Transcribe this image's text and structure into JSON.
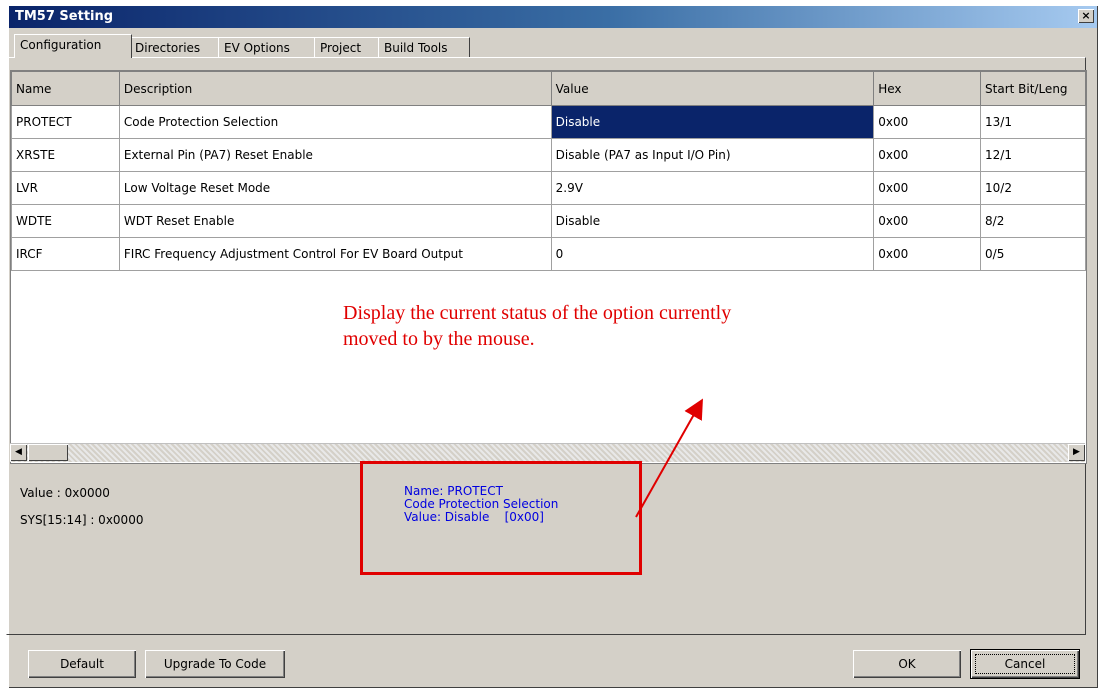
{
  "window": {
    "title": "TM57 Setting",
    "close_glyph": "×"
  },
  "tabs": [
    {
      "label": "Configuration"
    },
    {
      "label": "Directories"
    },
    {
      "label": "EV Options"
    },
    {
      "label": "Project"
    },
    {
      "label": "Build Tools"
    }
  ],
  "grid": {
    "columns": [
      "Name",
      "Description",
      "Value",
      "Hex",
      "Start Bit/Leng"
    ],
    "rows": [
      {
        "name": "PROTECT",
        "description": "Code Protection Selection",
        "value": "Disable",
        "hex": "0x00",
        "start": "13/1"
      },
      {
        "name": "XRSTE",
        "description": "External Pin (PA7) Reset Enable",
        "value": "Disable (PA7 as Input I/O Pin)",
        "hex": "0x00",
        "start": "12/1"
      },
      {
        "name": "LVR",
        "description": "Low Voltage Reset Mode",
        "value": "2.9V",
        "hex": "0x00",
        "start": "10/2"
      },
      {
        "name": "WDTE",
        "description": "WDT Reset Enable",
        "value": "Disable",
        "hex": "0x00",
        "start": "8/2"
      },
      {
        "name": "IRCF",
        "description": "FIRC Frequency Adjustment Control For EV Board Output",
        "value": "0",
        "hex": "0x00",
        "start": "0/5"
      }
    ],
    "selected_row": 0
  },
  "annotation": {
    "line1": "Display the current status of the option currently",
    "line2": "moved to by the mouse."
  },
  "status": {
    "value": "Value : 0x0000",
    "sys": "SYS[15:14] : 0x0000"
  },
  "info": {
    "name": "Name: PROTECT",
    "description": "Code Protection Selection",
    "value": "Value: Disable    [0x00]"
  },
  "buttons": {
    "default": "Default",
    "upgrade": "Upgrade To Code",
    "ok": "OK",
    "cancel": "Cancel"
  },
  "colors": {
    "annotation": "#e00000",
    "info_text": "#0000e0",
    "selection": "#0a246a"
  }
}
